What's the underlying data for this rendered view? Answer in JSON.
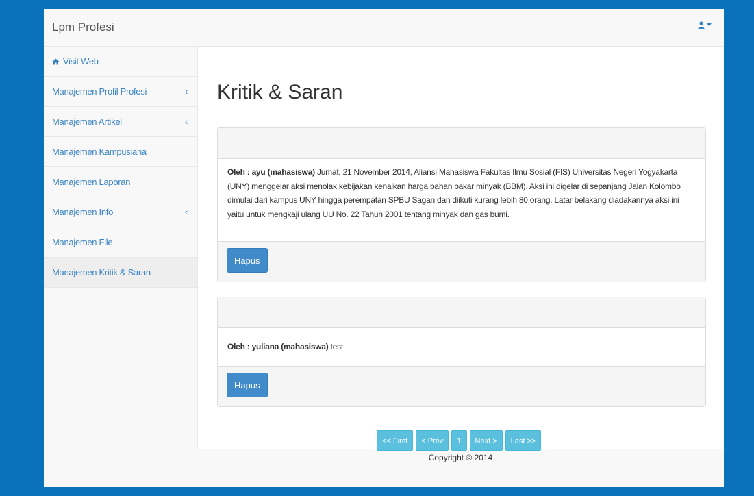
{
  "app": {
    "brand": "Lpm Profesi"
  },
  "sidebar": {
    "items": [
      {
        "label": "Visit Web"
      },
      {
        "label": "Manajemen Profil Profesi",
        "chevron": "‹"
      },
      {
        "label": "Manajemen Artikel",
        "chevron": "‹"
      },
      {
        "label": "Manajemen Kampusiana"
      },
      {
        "label": "Manajemen Laporan"
      },
      {
        "label": "Manajemen Info",
        "chevron": "‹"
      },
      {
        "label": "Manajemen File"
      },
      {
        "label": "Manajemen Kritik & Saran"
      }
    ]
  },
  "page": {
    "title": "Kritik & Saran"
  },
  "entries": [
    {
      "author": "Oleh : ayu (mahasiswa)",
      "text": "Jumat, 21 November 2014, Aliansi Mahasiswa Fakultas Ilmu Sosial (FIS) Universitas Negeri Yogyakarta (UNY) menggelar aksi menolak kebijakan kenaikan harga bahan bakar minyak (BBM). Aksi ini digelar di sepanjang Jalan Kolombo dimulai dari kampus UNY hingga perempatan SPBU Sagan dan diikuti kurang lebih 80 orang. Latar belakang diadakannya aksi ini yaitu untuk mengkaji ulang UU No. 22 Tahun 2001 tentang minyak dan gas bumi.",
      "delete_label": "Hapus"
    },
    {
      "author": "Oleh : yuliana (mahasiswa)",
      "text": "test",
      "delete_label": "Hapus"
    }
  ],
  "pagination": {
    "first": "<< First",
    "prev": "< Prev",
    "page": "1",
    "next": "Next >",
    "last": "Last >>"
  },
  "footer": {
    "copyright": "Copyright © 2014"
  },
  "colors": {
    "accent": "#428bca",
    "background": "#0a72b8",
    "pager": "#5bc0de"
  },
  "icons": {
    "user": "user-icon",
    "caret": "caret-down-icon",
    "home": "home-icon"
  }
}
